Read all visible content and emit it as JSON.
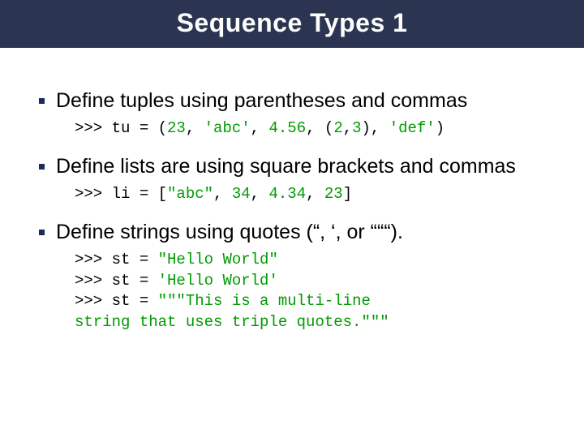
{
  "title": "Sequence Types 1",
  "items": [
    {
      "text": "Define tuples using parentheses and commas",
      "code_segments": [
        {
          "t": ">>> tu = (",
          "c": "plain"
        },
        {
          "t": "23",
          "c": "num"
        },
        {
          "t": ", ",
          "c": "plain"
        },
        {
          "t": "'abc'",
          "c": "str"
        },
        {
          "t": ", ",
          "c": "plain"
        },
        {
          "t": "4.56",
          "c": "num"
        },
        {
          "t": ", (",
          "c": "plain"
        },
        {
          "t": "2",
          "c": "num"
        },
        {
          "t": ",",
          "c": "plain"
        },
        {
          "t": "3",
          "c": "num"
        },
        {
          "t": "), ",
          "c": "plain"
        },
        {
          "t": "'def'",
          "c": "str"
        },
        {
          "t": ")",
          "c": "plain"
        }
      ]
    },
    {
      "text": "Define lists are using square brackets and commas",
      "code_segments": [
        {
          "t": ">>> li = [",
          "c": "plain"
        },
        {
          "t": "\"abc\"",
          "c": "str"
        },
        {
          "t": ", ",
          "c": "plain"
        },
        {
          "t": "34",
          "c": "num"
        },
        {
          "t": ", ",
          "c": "plain"
        },
        {
          "t": "4.34",
          "c": "num"
        },
        {
          "t": ", ",
          "c": "plain"
        },
        {
          "t": "23",
          "c": "num"
        },
        {
          "t": "]",
          "c": "plain"
        }
      ]
    },
    {
      "text": "Define strings using quotes (“, ‘, or “““).",
      "code_segments": [
        {
          "t": ">>> st = ",
          "c": "plain"
        },
        {
          "t": "\"Hello World\"",
          "c": "str"
        },
        {
          "t": "\n>>> st = ",
          "c": "plain"
        },
        {
          "t": "'Hello World'",
          "c": "str"
        },
        {
          "t": "\n>>> st = ",
          "c": "plain"
        },
        {
          "t": "\"\"\"This is a multi-line\nstring that uses triple quotes.\"\"\"",
          "c": "str"
        }
      ]
    }
  ]
}
